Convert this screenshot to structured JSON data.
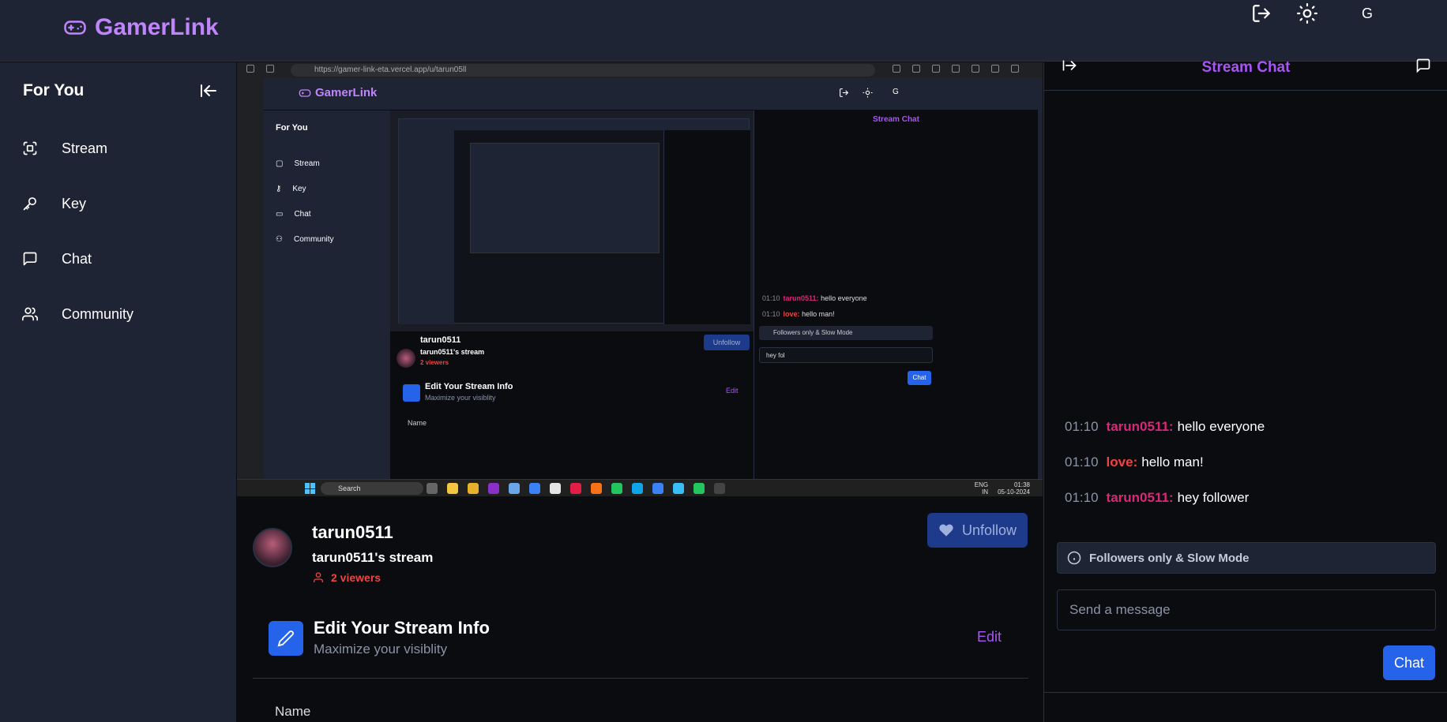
{
  "app": {
    "brand": "GamerLink",
    "avatar_letter": "G"
  },
  "sidebar": {
    "title": "For You",
    "items": [
      {
        "label": "Stream",
        "icon": "scan-icon"
      },
      {
        "label": "Key",
        "icon": "key-icon"
      },
      {
        "label": "Chat",
        "icon": "message-square-icon"
      },
      {
        "label": "Community",
        "icon": "users-icon"
      }
    ]
  },
  "embedded": {
    "url": "https://gamer-link-eta.vercel.app/u/tarun05ll",
    "brand": "GamerLink",
    "sidebar_title": "For You",
    "sidebar_items": [
      "Stream",
      "Key",
      "Chat",
      "Community"
    ],
    "chat_title": "Stream Chat",
    "messages": [
      {
        "time": "01:10",
        "user": "tarun0511:",
        "text": "hello everyone"
      },
      {
        "time": "01:10",
        "user": "love:",
        "text": "hello man!"
      }
    ],
    "mode": "Followers only & Slow Mode",
    "input_value": "hey fol",
    "chat_button": "Chat",
    "streamer_name": "tarun0511",
    "stream_title": "tarun0511's stream",
    "viewers": "2 viewers",
    "unfollow": "Unfollow",
    "edit_title": "Edit Your Stream Info",
    "edit_sub": "Maximize your visiblity",
    "edit_link": "Edit",
    "field_name": "Name",
    "taskbar_search": "Search",
    "lang_top": "ENG",
    "lang_bottom": "IN",
    "clock_time": "01:38",
    "clock_date": "05-10-2024"
  },
  "streamer": {
    "name": "tarun0511",
    "title": "tarun0511's stream",
    "viewers": "2 viewers",
    "unfollow_label": "Unfollow"
  },
  "edit": {
    "title": "Edit Your Stream Info",
    "subtitle": "Maximize your visiblity",
    "link": "Edit",
    "field_label": "Name"
  },
  "chat": {
    "title": "Stream Chat",
    "messages": [
      {
        "time": "01:10",
        "user": "tarun0511:",
        "text": "hello everyone",
        "color": "#db2777"
      },
      {
        "time": "01:10",
        "user": "love:",
        "text": "hello man!",
        "color": "#ef4444"
      },
      {
        "time": "01:10",
        "user": "tarun0511:",
        "text": "hey follower",
        "color": "#db2777"
      }
    ],
    "mode_label": "Followers only & Slow Mode",
    "input_placeholder": "Send a message",
    "send_label": "Chat"
  },
  "colors": {
    "accent": "#a855f7",
    "primary": "#2563eb",
    "danger": "#ef4444",
    "panel": "#1e2433"
  }
}
